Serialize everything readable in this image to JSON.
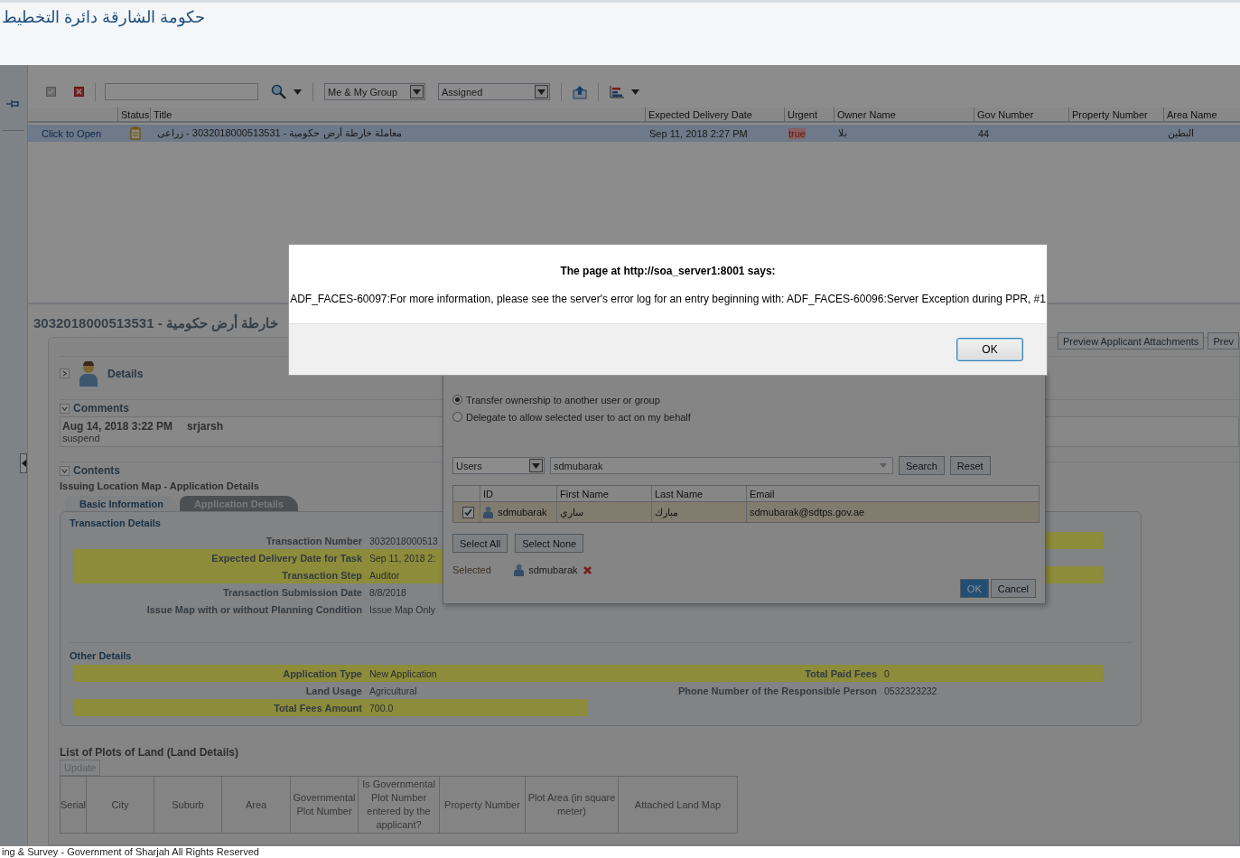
{
  "header": {
    "title": "حكومة الشارقة دائرة التخطيط"
  },
  "toolbar": {
    "assignee_filter": "Me & My Group",
    "status_filter": "Assigned"
  },
  "tasks": {
    "columns": [
      "Status",
      "Title",
      "Expected Delivery Date",
      "Urgent",
      "Owner Name",
      "Gov Number",
      "Property Number",
      "Area Name"
    ],
    "rows": [
      {
        "link": "Click to Open",
        "title": "معاملة خارطة أرض حكومية - 3032018000513531 - زراعى",
        "expected": "Sep 11, 2018 2:27 PM",
        "urgent": "true",
        "urgent_highlight": true,
        "owner": "بلا",
        "gov_number": "44",
        "area": "البطين",
        "selected": true
      }
    ]
  },
  "detail": {
    "title": "خارطة أرض حكومية - 3032018000513531",
    "actions": [
      "Preview Applicant Attachments",
      "Prev"
    ],
    "details": {
      "label": "Details",
      "expanded": false
    },
    "comments": {
      "label": "Comments",
      "expanded": true,
      "entries": [
        {
          "date": "Aug 14, 2018 3:22 PM",
          "user": "srjarsh",
          "text": "suspend"
        }
      ]
    },
    "contents": {
      "label": "Contents",
      "expanded": true,
      "form_title": "Issuing Location Map - Application Details",
      "tabs": [
        {
          "label": "Basic Information",
          "selected": true
        },
        {
          "label": "Application Details",
          "selected": false
        }
      ],
      "transaction_details": {
        "title": "Transaction Details",
        "left": [
          {
            "label": "Transaction Number",
            "value": "3032018000513",
            "highlighted": false
          },
          {
            "label": "Expected Delivery Date for Task",
            "value": "Sep 11, 2018 2:",
            "highlighted": true
          },
          {
            "label": "Transaction Step",
            "value": "Auditor",
            "highlighted": true
          },
          {
            "label": "Transaction Submission Date",
            "value": "8/8/2018",
            "highlighted": false
          },
          {
            "label": "Issue Map with or without Planning Condition",
            "value": "Issue Map Only",
            "highlighted": false
          }
        ],
        "right": [
          {
            "highlighted": true
          },
          {
            "highlighted": false
          },
          {
            "highlighted": true
          }
        ]
      },
      "other_details": {
        "title": "Other Details",
        "rows": [
          {
            "left": {
              "label": "Application Type",
              "value": "New Application",
              "highlighted": true
            },
            "right": {
              "label": "Total Paid Fees",
              "value": "0",
              "highlighted": true
            }
          },
          {
            "left": {
              "label": "Land Usage",
              "value": "Agricultural",
              "highlighted": false
            },
            "right": {
              "label": "Phone Number of the Responsible Person",
              "value": "0532323232",
              "highlighted": false
            }
          },
          {
            "left": {
              "label": "Total Fees Amount",
              "value": "700.0",
              "highlighted": true
            }
          }
        ]
      },
      "plots": {
        "title": "List of Plots of Land (Land Details)",
        "update_button": {
          "label": "Update",
          "disabled": true
        },
        "columns": [
          "Serial",
          "City",
          "Suburb",
          "Area",
          "Governmental Plot Number",
          "Is Governmental Plot Number entered by the applicant?",
          "Property Number",
          "Plot Area (in square meter)",
          "Attached Land Map"
        ]
      }
    }
  },
  "reassign_dialog": {
    "options": [
      {
        "label": "Transfer ownership to another user or group",
        "selected": true
      },
      {
        "label": "Delegate to allow selected user to act on my behalf",
        "selected": false
      }
    ],
    "identity_type": "Users",
    "search_value": "sdmubarak",
    "search_button": "Search",
    "reset_button": "Reset",
    "columns": [
      "ID",
      "First Name",
      "Last Name",
      "Email"
    ],
    "rows": [
      {
        "checked": true,
        "id": "sdmubarak",
        "first_name": "ساري",
        "last_name": "مبارك",
        "email": "sdmubarak@sdtps.gov.ae"
      }
    ],
    "select_all": "Select All",
    "select_none": "Select None",
    "selected_label": "Selected",
    "selected_users": [
      "sdmubarak"
    ],
    "ok": "OK",
    "cancel": "Cancel"
  },
  "alert": {
    "title": "The page at http://soa_server1:8001 says:",
    "message": "ADF_FACES-60097:For more information, please see the server's error log for an entry beginning with: ADF_FACES-60096:Server Exception during PPR, #1",
    "ok": "OK"
  },
  "footer": {
    "text": "ing & Survey - Government of Sharjah All Rights Reserved"
  }
}
